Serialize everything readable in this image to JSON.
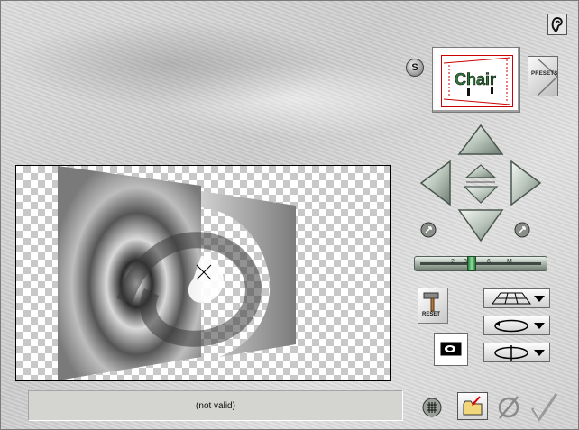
{
  "status": {
    "text": "(not valid)"
  },
  "presets": {
    "s_label": "S",
    "presets_label": "PRESETS",
    "thumbnail_text": "Chair"
  },
  "slider": {
    "marks": [
      "2",
      "3",
      "6",
      "M"
    ],
    "value": 0.43
  },
  "reset": {
    "label": "RESET"
  },
  "icons": {
    "help": "help-ear-icon",
    "nav_up": "triangle-up-icon",
    "nav_down": "triangle-down-icon",
    "nav_left": "triangle-left-icon",
    "nav_right": "triangle-right-icon",
    "center_up": "small-triangle-up-icon",
    "center_down": "small-triangle-down-icon",
    "rotate_left": "rotate-ccw-icon",
    "rotate_right": "rotate-cw-icon",
    "perspective": "perspective-grid-icon",
    "rotate_ellipse": "ellipse-rotate-icon",
    "flip_ellipse": "ellipse-flip-icon",
    "grid": "grid-icon",
    "open_folder": "folder-open-icon",
    "cancel": "cancel-slash-icon",
    "ok": "checkmark-icon"
  },
  "colors": {
    "accent_green": "#2b7a3e",
    "thumbnail_border": "#cc0000"
  }
}
